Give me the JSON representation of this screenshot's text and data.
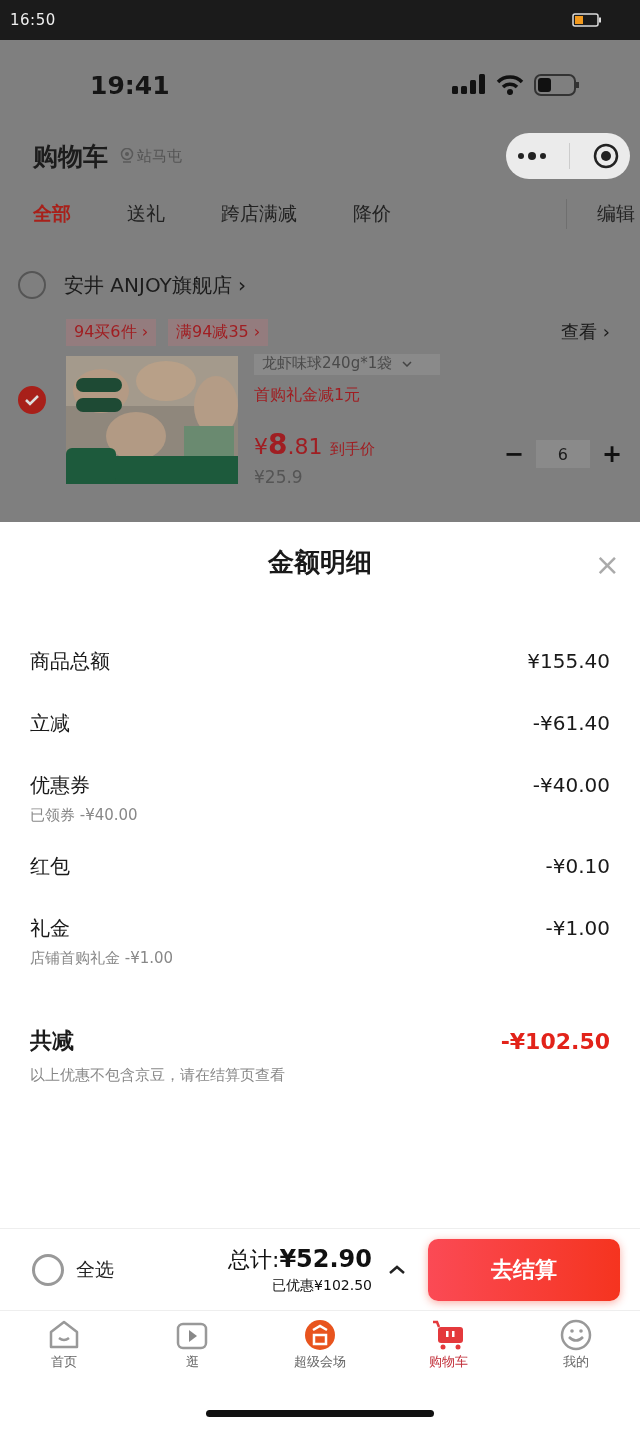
{
  "device_status": {
    "time": "16:50"
  },
  "phone_status": {
    "time": "19:41"
  },
  "header": {
    "title": "购物车",
    "location": "站马屯"
  },
  "tabs": [
    {
      "label": "全部",
      "selected": true
    },
    {
      "label": "送礼",
      "selected": false
    },
    {
      "label": "跨店满减",
      "selected": false
    },
    {
      "label": "降价",
      "selected": false
    }
  ],
  "edit_label": "编辑",
  "store": {
    "name": "安井 ANJOY旗舰店",
    "chevron": "›",
    "checked": false
  },
  "promos": [
    {
      "label": "94买6件",
      "chevron": "›"
    },
    {
      "label": "满94减35",
      "chevron": "›"
    }
  ],
  "view_label": "查看",
  "view_chevron": "›",
  "product": {
    "checked": true,
    "variant": "龙虾味球240g*1袋",
    "promo": "首购礼金减1元",
    "currency": "¥",
    "price_int": "8",
    "price_dec": ".81",
    "price_note": "到手价",
    "original_price": "¥25.9",
    "minus": "−",
    "quantity": "6",
    "plus": "+"
  },
  "sheet": {
    "title": "金额明细",
    "close": "×",
    "footnote": "以上优惠不包含京豆，请在结算页查看",
    "rows": [
      {
        "kind": "normal",
        "label": "商品总额",
        "amount": "¥155.40"
      },
      {
        "kind": "normal",
        "label": "立减",
        "amount": "-¥61.40"
      },
      {
        "kind": "normal",
        "label": "优惠券",
        "amount": "-¥40.00",
        "note": "已领券 -¥40.00"
      },
      {
        "kind": "normal",
        "label": "红包",
        "amount": "-¥0.10"
      },
      {
        "kind": "normal",
        "label": "礼金",
        "amount": "-¥1.00",
        "note": "店铺首购礼金 -¥1.00"
      },
      {
        "kind": "total",
        "label": "共减",
        "amount": "-¥102.50"
      }
    ]
  },
  "checkout": {
    "select_all": {
      "label": "全选",
      "checked": false
    },
    "total_label": "总计:",
    "total": "¥52.90",
    "saved": "已优惠¥102.50",
    "button": "去结算"
  },
  "nav": [
    {
      "kind": "home",
      "label": "首页",
      "selected": false
    },
    {
      "kind": "play",
      "label": "逛",
      "selected": false
    },
    {
      "kind": "venue",
      "label": "超级会场",
      "selected": false
    },
    {
      "kind": "cart",
      "label": "购物车",
      "selected": true
    },
    {
      "kind": "me",
      "label": "我的",
      "selected": false
    }
  ]
}
